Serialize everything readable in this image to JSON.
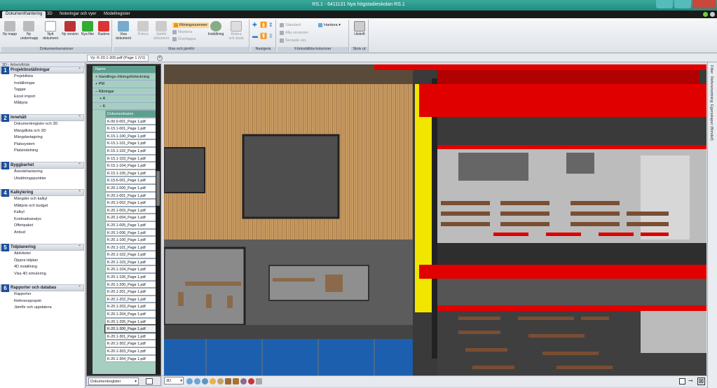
{
  "window": {
    "title": "RS.1 - 6411131 Nya högstadieskolan RS.1"
  },
  "ribbon_tabs": [
    "Dokumenthantering",
    "3D",
    "Noteringar och vyer",
    "Modellregister"
  ],
  "ribbon": {
    "groups": {
      "docversions": "Dokumentversioner",
      "view": "Visa och jämför",
      "navigate": "Navigera",
      "columns": "Förinställda kolumner",
      "print": "Skriv ut"
    },
    "buttons": {
      "new_folder": "Ny mapp",
      "new_subfolder": "Ny undermapp",
      "new_document": "Nytt dokument",
      "new_version": "Ny version",
      "new_files": "Nya filer",
      "delete": "Radera",
      "show_document": "Visa dokument",
      "rotate": "Rotera",
      "compare": "Jämför dokument",
      "markings": "Ritningsnummer",
      "mark": "Markera",
      "overlap": "Överlappa",
      "settings": "Inställning",
      "rotate_scale": "Rotera och skala",
      "standard": "Standard",
      "all_versions": "Alla versioner",
      "latest_ver": "Senaste ver.",
      "manage": "Hantera",
      "print": "Utskrift"
    }
  },
  "doc_tab": {
    "label": "Vy: K-20.1-300.pdf (Page 1 (V1)"
  },
  "left_panel": {
    "header": "3D - Arbetsflöde",
    "sections": [
      {
        "num": "1",
        "title": "Projektinställningar",
        "items": [
          "Projektlista",
          "Inställningar",
          "Taggar",
          "Excel import",
          "Måttpris"
        ]
      },
      {
        "num": "2",
        "title": "Innehåll",
        "items": [
          "Dokumentregister och 3D",
          "Mängdlista och 3D",
          "Mängdavtagning",
          "Platssystem",
          "Platsindelning"
        ]
      },
      {
        "num": "3",
        "title": "Byggbarhet",
        "items": [
          "Ärendehantering",
          "Utsättningspunkter"
        ]
      },
      {
        "num": "4",
        "title": "Kalkylering",
        "items": [
          "Mängder och kalkyl",
          "Måttpris och budget",
          "Kalkyl",
          "Kostnadsanalys",
          "Offertpaket",
          "Anbud"
        ]
      },
      {
        "num": "5",
        "title": "Tidplanering",
        "items": [
          "Aktiviteter",
          "Öppna tidplan",
          "4D inställning",
          "Visa 4D simulering"
        ]
      },
      {
        "num": "6",
        "title": "Rapporter och databas",
        "items": [
          "Rapporter",
          "Referensprojekt",
          "Jämför och uppdatera"
        ]
      }
    ]
  },
  "tree": {
    "column_header": "Namn",
    "nodes": [
      "Handlings-/ritningsförteckning",
      "PM",
      "Ritningar",
      "A",
      "K"
    ],
    "files_header": "Dokumentnamn",
    "files": [
      "K-00.0-001_Page 1.pdf",
      "K-15.1-001_Page 1.pdf",
      "K-15.1-100_Page 1.pdf",
      "K-15.1-101_Page 1.pdf",
      "K-15.1-102_Page 1.pdf",
      "K-15.1-103_Page 1.pdf",
      "K-15.1-104_Page 1.pdf",
      "K-15.1-105_Page 1.pdf",
      "K-15.6-001_Page 1.pdf",
      "K-20.1-000_Page 1.pdf",
      "K-20.1-001_Page 1.pdf",
      "K-20.1-002_Page 1.pdf",
      "K-20.1-003_Page 1.pdf",
      "K-20.1-004_Page 1.pdf",
      "K-20.1-005_Page 1.pdf",
      "K-20.1-006_Page 1.pdf",
      "K-20.1-100_Page 1.pdf",
      "K-20.1-101_Page 1.pdf",
      "K-20.1-102_Page 1.pdf",
      "K-20.1-103_Page 1.pdf",
      "K-20.1-104_Page 1.pdf",
      "K-20.1-105_Page 1.pdf",
      "K-20.1-200_Page 1.pdf",
      "K-20.1-201_Page 1.pdf",
      "K-20.1-202_Page 1.pdf",
      "K-20.1-203_Page 1.pdf",
      "K-20.1-204_Page 1.pdf",
      "K-20.1-205_Page 1.pdf",
      "K-20.1-300_Page 1.pdf",
      "K-20.1-301_Page 1.pdf",
      "K-20.1-302_Page 1.pdf",
      "K-20.1-303_Page 1.pdf",
      "K-20.1-304_Page 1.pdf"
    ],
    "selected_file": "K-20.1-300_Page 1.pdf"
  },
  "bottom_left": {
    "select_value": "Dokumentregister"
  },
  "bottom_toolbar": {
    "view_mode": "3D"
  },
  "right_strip": {
    "labels": [
      "Filter",
      "Referensritning",
      "Egenskaper (Bimdef)"
    ]
  }
}
